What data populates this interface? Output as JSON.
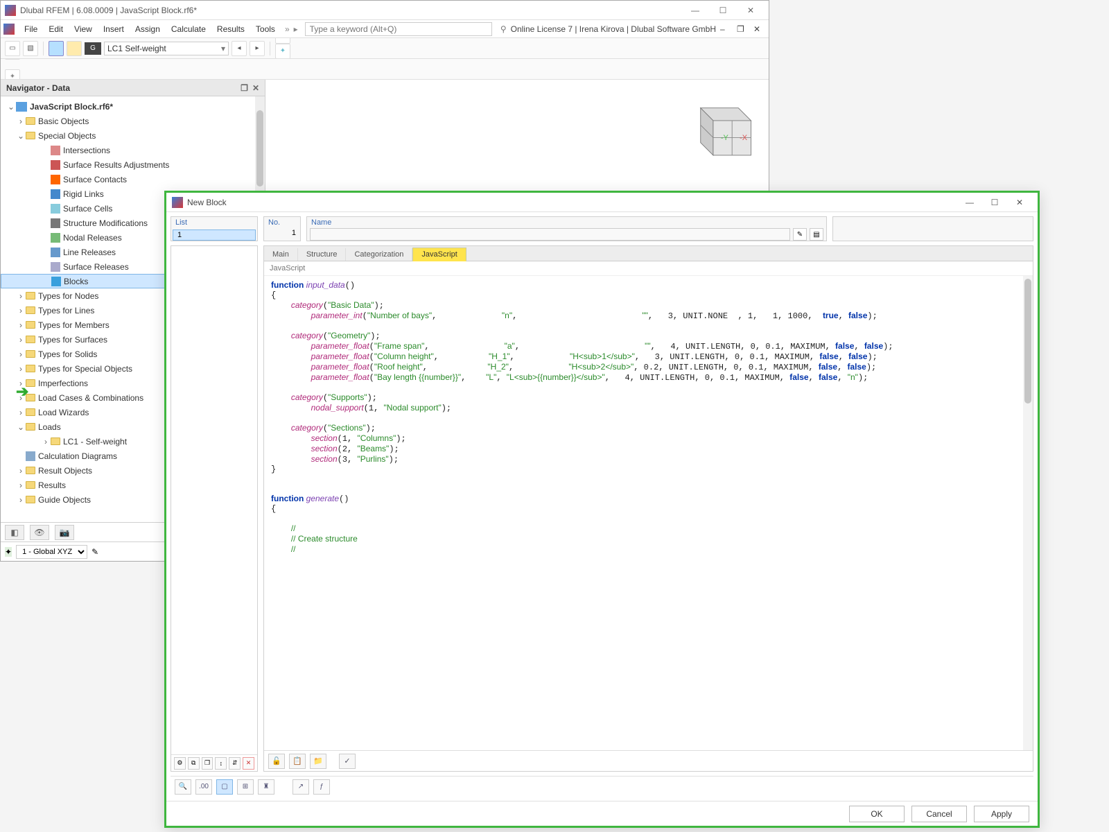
{
  "titlebar": {
    "text": "Dlubal RFEM | 6.08.0009 | JavaScript Block.rf6*"
  },
  "menubar": {
    "items": [
      "File",
      "Edit",
      "View",
      "Insert",
      "Assign",
      "Calculate",
      "Results",
      "Tools"
    ],
    "overflow": "»",
    "search_placeholder": "Type a keyword (Alt+Q)",
    "right_text": "Online License 7 | Irena Kirova | Dlubal Software GmbH"
  },
  "toolbar1": {
    "lc_badge": "G",
    "lc_select": "LC1   Self-weight"
  },
  "navigator": {
    "title": "Navigator - Data",
    "root": "JavaScript Block.rf6*",
    "folders": {
      "basic": "Basic Objects",
      "special": "Special Objects"
    },
    "special_items": [
      "Intersections",
      "Surface Results Adjustments",
      "Surface Contacts",
      "Rigid Links",
      "Surface Cells",
      "Structure Modifications",
      "Nodal Releases",
      "Line Releases",
      "Surface Releases",
      "Blocks"
    ],
    "after_blocks": [
      "Types for Nodes",
      "Types for Lines",
      "Types for Members",
      "Types for Surfaces",
      "Types for Solids",
      "Types for Special Objects",
      "Imperfections",
      "Load Cases & Combinations",
      "Load Wizards",
      "Loads"
    ],
    "loads_child": "LC1 - Self-weight",
    "tail": [
      "Calculation Diagrams",
      "Result Objects",
      "Results",
      "Guide Objects"
    ],
    "footer_coord": "1 - Global XYZ"
  },
  "dialog": {
    "title": "New Block",
    "headers": {
      "list": "List",
      "no": "No.",
      "name": "Name"
    },
    "list_item": "1",
    "no_value": "1",
    "tabs": [
      "Main",
      "Structure",
      "Categorization",
      "JavaScript"
    ],
    "active_tab": 3,
    "subhead": "JavaScript",
    "buttons": {
      "ok": "OK",
      "cancel": "Cancel",
      "apply": "Apply"
    },
    "code_lines": [
      {
        "t": "line",
        "parts": [
          {
            "c": "kw",
            "v": "function "
          },
          {
            "c": "fn",
            "v": "input_data"
          },
          {
            "c": "",
            "v": "()"
          }
        ]
      },
      {
        "t": "line",
        "parts": [
          {
            "c": "",
            "v": "{"
          }
        ]
      },
      {
        "t": "line",
        "parts": [
          {
            "c": "",
            "v": "    "
          },
          {
            "c": "call",
            "v": "category"
          },
          {
            "c": "",
            "v": "("
          },
          {
            "c": "str",
            "v": "\"Basic Data\""
          },
          {
            "c": "",
            "v": ");"
          }
        ]
      },
      {
        "t": "line",
        "parts": [
          {
            "c": "",
            "v": "        "
          },
          {
            "c": "call",
            "v": "parameter_int"
          },
          {
            "c": "",
            "v": "("
          },
          {
            "c": "str",
            "v": "\"Number of bays\""
          },
          {
            "c": "",
            "v": ",             "
          },
          {
            "c": "str",
            "v": "\"n\""
          },
          {
            "c": "",
            "v": ",                         "
          },
          {
            "c": "str",
            "v": "\"\""
          },
          {
            "c": "",
            "v": ",   3, UNIT.NONE  , 1,   1, 1000,  "
          },
          {
            "c": "kw",
            "v": "true"
          },
          {
            "c": "",
            "v": ", "
          },
          {
            "c": "kw",
            "v": "false"
          },
          {
            "c": "",
            "v": ");"
          }
        ]
      },
      {
        "t": "blank"
      },
      {
        "t": "line",
        "parts": [
          {
            "c": "",
            "v": "    "
          },
          {
            "c": "call",
            "v": "category"
          },
          {
            "c": "",
            "v": "("
          },
          {
            "c": "str",
            "v": "\"Geometry\""
          },
          {
            "c": "",
            "v": ");"
          }
        ]
      },
      {
        "t": "line",
        "parts": [
          {
            "c": "",
            "v": "        "
          },
          {
            "c": "call",
            "v": "parameter_float"
          },
          {
            "c": "",
            "v": "("
          },
          {
            "c": "str",
            "v": "\"Frame span\""
          },
          {
            "c": "",
            "v": ",               "
          },
          {
            "c": "str",
            "v": "\"a\""
          },
          {
            "c": "",
            "v": ",                         "
          },
          {
            "c": "str",
            "v": "\"\""
          },
          {
            "c": "",
            "v": ",   4, UNIT.LENGTH, 0, 0.1, MAXIMUM, "
          },
          {
            "c": "kw",
            "v": "false"
          },
          {
            "c": "",
            "v": ", "
          },
          {
            "c": "kw",
            "v": "false"
          },
          {
            "c": "",
            "v": ");"
          }
        ]
      },
      {
        "t": "line",
        "parts": [
          {
            "c": "",
            "v": "        "
          },
          {
            "c": "call",
            "v": "parameter_float"
          },
          {
            "c": "",
            "v": "("
          },
          {
            "c": "str",
            "v": "\"Column height\""
          },
          {
            "c": "",
            "v": ",          "
          },
          {
            "c": "str",
            "v": "\"H_1\""
          },
          {
            "c": "",
            "v": ",           "
          },
          {
            "c": "str",
            "v": "\"H<sub>1</sub>\""
          },
          {
            "c": "",
            "v": ",   3, UNIT.LENGTH, 0, 0.1, MAXIMUM, "
          },
          {
            "c": "kw",
            "v": "false"
          },
          {
            "c": "",
            "v": ", "
          },
          {
            "c": "kw",
            "v": "false"
          },
          {
            "c": "",
            "v": ");"
          }
        ]
      },
      {
        "t": "line",
        "parts": [
          {
            "c": "",
            "v": "        "
          },
          {
            "c": "call",
            "v": "parameter_float"
          },
          {
            "c": "",
            "v": "("
          },
          {
            "c": "str",
            "v": "\"Roof height\""
          },
          {
            "c": "",
            "v": ",            "
          },
          {
            "c": "str",
            "v": "\"H_2\""
          },
          {
            "c": "",
            "v": ",           "
          },
          {
            "c": "str",
            "v": "\"H<sub>2</sub>\""
          },
          {
            "c": "",
            "v": ", 0.2, UNIT.LENGTH, 0, 0.1, MAXIMUM, "
          },
          {
            "c": "kw",
            "v": "false"
          },
          {
            "c": "",
            "v": ", "
          },
          {
            "c": "kw",
            "v": "false"
          },
          {
            "c": "",
            "v": ");"
          }
        ]
      },
      {
        "t": "line",
        "parts": [
          {
            "c": "",
            "v": "        "
          },
          {
            "c": "call",
            "v": "parameter_float"
          },
          {
            "c": "",
            "v": "("
          },
          {
            "c": "str",
            "v": "\"Bay length {{number}}\""
          },
          {
            "c": "",
            "v": ",    "
          },
          {
            "c": "str",
            "v": "\"L\""
          },
          {
            "c": "",
            "v": ", "
          },
          {
            "c": "str",
            "v": "\"L<sub>{{number}}</sub>\""
          },
          {
            "c": "",
            "v": ",   4, UNIT.LENGTH, 0, 0.1, MAXIMUM, "
          },
          {
            "c": "kw",
            "v": "false"
          },
          {
            "c": "",
            "v": ", "
          },
          {
            "c": "kw",
            "v": "false"
          },
          {
            "c": "",
            "v": ", "
          },
          {
            "c": "str",
            "v": "\"n\""
          },
          {
            "c": "",
            "v": ");"
          }
        ]
      },
      {
        "t": "blank"
      },
      {
        "t": "line",
        "parts": [
          {
            "c": "",
            "v": "    "
          },
          {
            "c": "call",
            "v": "category"
          },
          {
            "c": "",
            "v": "("
          },
          {
            "c": "str",
            "v": "\"Supports\""
          },
          {
            "c": "",
            "v": ");"
          }
        ]
      },
      {
        "t": "line",
        "parts": [
          {
            "c": "",
            "v": "        "
          },
          {
            "c": "call",
            "v": "nodal_support"
          },
          {
            "c": "",
            "v": "(1, "
          },
          {
            "c": "str",
            "v": "\"Nodal support\""
          },
          {
            "c": "",
            "v": ");"
          }
        ]
      },
      {
        "t": "blank"
      },
      {
        "t": "line",
        "parts": [
          {
            "c": "",
            "v": "    "
          },
          {
            "c": "call",
            "v": "category"
          },
          {
            "c": "",
            "v": "("
          },
          {
            "c": "str",
            "v": "\"Sections\""
          },
          {
            "c": "",
            "v": ");"
          }
        ]
      },
      {
        "t": "line",
        "parts": [
          {
            "c": "",
            "v": "        "
          },
          {
            "c": "call",
            "v": "section"
          },
          {
            "c": "",
            "v": "(1, "
          },
          {
            "c": "str",
            "v": "\"Columns\""
          },
          {
            "c": "",
            "v": ");"
          }
        ]
      },
      {
        "t": "line",
        "parts": [
          {
            "c": "",
            "v": "        "
          },
          {
            "c": "call",
            "v": "section"
          },
          {
            "c": "",
            "v": "(2, "
          },
          {
            "c": "str",
            "v": "\"Beams\""
          },
          {
            "c": "",
            "v": ");"
          }
        ]
      },
      {
        "t": "line",
        "parts": [
          {
            "c": "",
            "v": "        "
          },
          {
            "c": "call",
            "v": "section"
          },
          {
            "c": "",
            "v": "(3, "
          },
          {
            "c": "str",
            "v": "\"Purlins\""
          },
          {
            "c": "",
            "v": ");"
          }
        ]
      },
      {
        "t": "line",
        "parts": [
          {
            "c": "",
            "v": "}"
          }
        ]
      },
      {
        "t": "blank"
      },
      {
        "t": "blank"
      },
      {
        "t": "line",
        "parts": [
          {
            "c": "kw",
            "v": "function "
          },
          {
            "c": "fn",
            "v": "generate"
          },
          {
            "c": "",
            "v": "()"
          }
        ]
      },
      {
        "t": "line",
        "parts": [
          {
            "c": "",
            "v": "{"
          }
        ]
      },
      {
        "t": "blank"
      },
      {
        "t": "line",
        "parts": [
          {
            "c": "",
            "v": "    "
          },
          {
            "c": "cmt",
            "v": "//"
          }
        ]
      },
      {
        "t": "line",
        "parts": [
          {
            "c": "",
            "v": "    "
          },
          {
            "c": "cmt",
            "v": "// Create structure"
          }
        ]
      },
      {
        "t": "line",
        "parts": [
          {
            "c": "",
            "v": "    "
          },
          {
            "c": "cmt",
            "v": "//"
          }
        ]
      }
    ]
  }
}
